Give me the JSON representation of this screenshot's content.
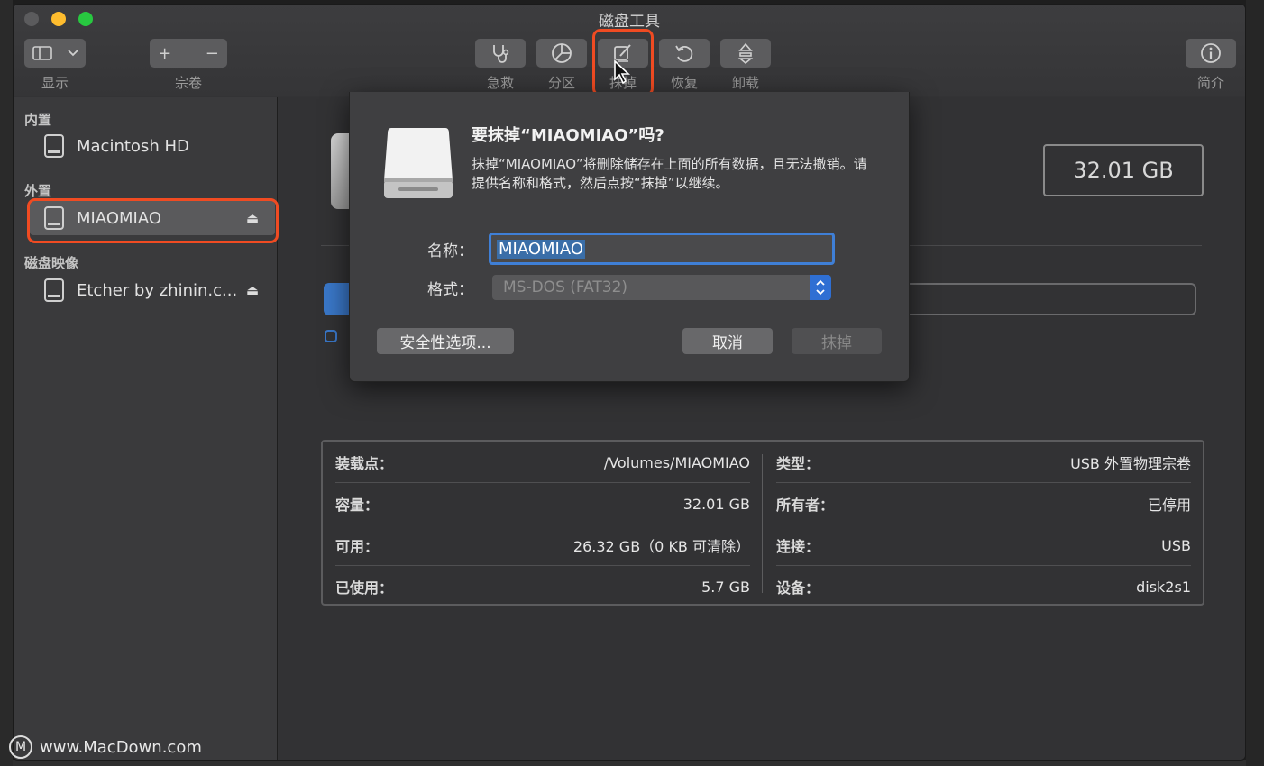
{
  "window": {
    "title": "磁盘工具"
  },
  "toolbar": {
    "view_label": "显示",
    "volume_label": "宗卷",
    "first_aid_label": "急救",
    "partition_label": "分区",
    "erase_label": "抹掉",
    "restore_label": "恢复",
    "unmount_label": "卸载",
    "info_label": "简介",
    "add_symbol": "+",
    "remove_symbol": "−"
  },
  "sidebar": {
    "sections": [
      {
        "header": "内置",
        "items": [
          {
            "label": "Macintosh HD",
            "icon": "internal-disk-icon"
          }
        ]
      },
      {
        "header": "外置",
        "items": [
          {
            "label": "MIAOMIAO",
            "icon": "external-disk-icon",
            "selected": true
          }
        ]
      },
      {
        "header": "磁盘映像",
        "items": [
          {
            "label": "Etcher by zhinin.c...",
            "icon": "disk-image-icon"
          }
        ]
      }
    ],
    "eject_symbol": "⏏"
  },
  "main": {
    "capacity_badge": "32.01 GB",
    "info": {
      "left": [
        {
          "key": "装载点：",
          "value": "/Volumes/MIAOMIAO"
        },
        {
          "key": "容量：",
          "value": "32.01 GB"
        },
        {
          "key": "可用：",
          "value": "26.32 GB（0 KB 可清除）"
        },
        {
          "key": "已使用：",
          "value": "5.7 GB"
        }
      ],
      "right": [
        {
          "key": "类型：",
          "value": "USB 外置物理宗卷"
        },
        {
          "key": "所有者：",
          "value": "已停用"
        },
        {
          "key": "连接：",
          "value": "USB"
        },
        {
          "key": "设备：",
          "value": "disk2s1"
        }
      ]
    }
  },
  "dialog": {
    "title": "要抹掉“MIAOMIAO”吗?",
    "description": "抹掉“MIAOMIAO”将删除储存在上面的所有数据，且无法撤销。请提供名称和格式，然后点按“抹掉”以继续。",
    "name_label": "名称：",
    "name_value": "MIAOMIAO",
    "format_label": "格式：",
    "format_value": "MS-DOS (FAT32)",
    "security_button": "安全性选项...",
    "cancel_button": "取消",
    "erase_button": "抹掉"
  },
  "watermark": {
    "text": "www.MacDown.com"
  },
  "colors": {
    "highlight": "#f04b22",
    "accent": "#3f7fd6"
  }
}
